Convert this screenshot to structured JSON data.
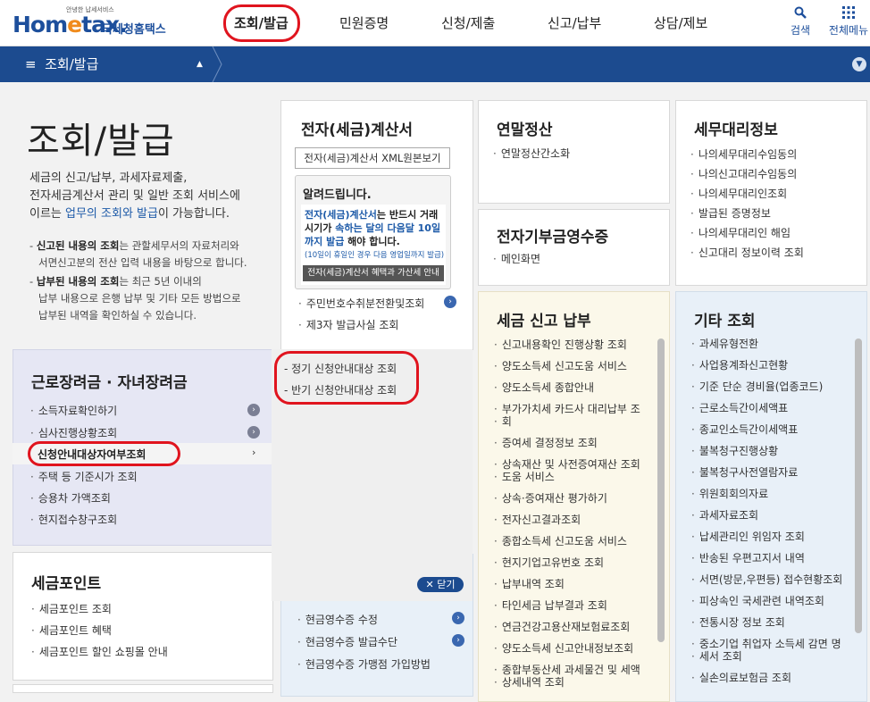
{
  "header": {
    "logo_small": "안녕한 납세서비스",
    "logo_main_1": "Hom",
    "logo_main_e": "e",
    "logo_main_2": "tax.",
    "logo_kr": "국세청홈택스",
    "nav": [
      "조회/발급",
      "민원증명",
      "신청/제출",
      "신고/납부",
      "상담/제보"
    ],
    "search_label": "검색",
    "allmenu_label": "전체메뉴"
  },
  "bar": {
    "menu_label": "조회/발급"
  },
  "intro": {
    "title": "조회/발급",
    "desc_1": "세금의 신고/납부, 과세자료제출,",
    "desc_2": "전자세금계산서 관리 및 일반 조회 서비스에",
    "desc_3a": "이르는 ",
    "desc_3b": "업무의 조회와 발급",
    "desc_3c": "이 가능합니다.",
    "note1_bold": "신고된 내용의 조회",
    "note1_rest": "는 관할세무서의 자료처리와",
    "note1_l2": "서면신고분의 전산 입력 내용을 바탕으로 합니다.",
    "note2_bold": "납부된 내용의 조회",
    "note2_rest": "는 최근 5년 이내의",
    "note2_l2": "납부 내용으로 은행 납부 및 기타 모든 방법으로",
    "note2_l3": "납부된 내역을 확인하실 수 있습니다."
  },
  "einvoice": {
    "title": "전자(세금)계산서",
    "xml_button": "전자(세금)계산서 XML원본보기",
    "notice_title": "알려드립니다.",
    "notice_b1": "전자(세금)계산서",
    "notice_t1": "는 반드시 거래시기가 ",
    "notice_b2": "속하는 달의 다음달 10일까지 발급",
    "notice_t2": " 해야 합니다.",
    "notice_small": "(10일이 휴일인 경우 다음 영업일까지 발급)",
    "notice_bar": "전자(세금)계산서 혜택과 가산세 안내",
    "items": [
      "주민번호수취분전환및조회",
      "제3자 발급사실 조회"
    ]
  },
  "yearend": {
    "title": "연말정산",
    "items": [
      "연말정산간소화"
    ]
  },
  "donation": {
    "title": "전자기부금영수증",
    "items": [
      "메인화면"
    ]
  },
  "agent": {
    "title": "세무대리정보",
    "items": [
      "나의세무대리수임동의",
      "나의신고대리수임동의",
      "나의세무대리인조회",
      "발급된 증명정보",
      "나의세무대리인 해임",
      "신고대리 정보이력 조회"
    ]
  },
  "labor": {
    "title": "근로장려금 · 자녀장려금",
    "items": [
      "소득자료확인하기",
      "심사진행상황조회",
      "신청안내대상자여부조회",
      "주택 등 기준시가 조회",
      "승용차 가액조회",
      "현지접수창구조회"
    ],
    "arrow": "›"
  },
  "submenu": {
    "items": [
      "- 정기 신청안내대상 조회",
      "- 반기 신청안내대상 조회"
    ],
    "close_label": "✕ 닫기"
  },
  "points": {
    "title": "세금포인트",
    "items": [
      "세금포인트 조회",
      "세금포인트 혜택",
      "세금포인트 할인 쇼핑몰 안내"
    ]
  },
  "cashreceipt": {
    "items": [
      "현금영수증 수정",
      "현금영수증 발급수단",
      "현금영수증 가맹점 가입방법"
    ]
  },
  "taxpay": {
    "title": "세금 신고 납부",
    "items": [
      "신고내용확인 진행상황 조회",
      "양도소득세 신고도움 서비스",
      "양도소득세 종합안내",
      "부가가치세 카드사 대리납부 조",
      "회",
      "증여세 결정정보 조회",
      "상속재산 및 사전증여재산 조회",
      "도움 서비스",
      "상속·증여재산 평가하기",
      "전자신고결과조회",
      "종합소득세 신고도움 서비스",
      "현지기업고유번호 조회",
      "납부내역 조회",
      "타인세금 납부결과 조회",
      "연금건강고용산재보험료조회",
      "양도소득세 신고안내정보조회",
      "종합부동산세 과세물건 및 세액",
      "상세내역 조회"
    ]
  },
  "etc": {
    "title": "기타 조회",
    "items": [
      "과세유형전환",
      "사업용계좌신고현황",
      "기준 단순 경비율(업종코드)",
      "근로소득간이세액표",
      "종교인소득간이세액표",
      "불복청구진행상황",
      "불복청구사전열람자료",
      "위원회회의자료",
      "과세자료조회",
      "납세관리인 위임자 조회",
      "반송된 우편고지서 내역",
      "서면(방문,우편등) 접수현황조회",
      "피상속인 국세관련 내역조회",
      "전통시장 정보 조회",
      "중소기업 취업자 소득세 감면 명",
      "세서 조회",
      "실손의료보험금 조회"
    ]
  },
  "colors": {
    "brand": "#1c4b8f",
    "highlight": "#e0141e",
    "accent": "#f08b1c"
  }
}
